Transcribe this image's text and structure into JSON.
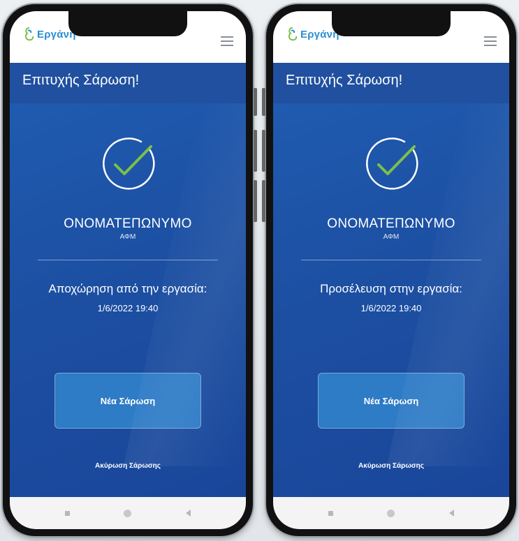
{
  "brand": {
    "logo_text": "Εργάνη",
    "accent_color": "#2a8fd1",
    "header_color": "#20509f"
  },
  "screens": [
    {
      "title": "Επιτυχής Σάρωση!",
      "name": "ΟΝΟΜΑΤΕΠΩΝΥΜΟ",
      "afm_label": "ΑΦΜ",
      "action_label": "Αποχώρηση από την εργασία:",
      "datetime": "1/6/2022 19:40",
      "new_scan_button": "Νέα Σάρωση",
      "cancel_scan_link": "Ακύρωση Σάρωσης"
    },
    {
      "title": "Επιτυχής Σάρωση!",
      "name": "ΟΝΟΜΑΤΕΠΩΝΥΜΟ",
      "afm_label": "ΑΦΜ",
      "action_label": "Προσέλευση στην εργασία:",
      "datetime": "1/6/2022 19:40",
      "new_scan_button": "Νέα Σάρωση",
      "cancel_scan_link": "Ακύρωση Σάρωσης"
    }
  ],
  "icons": {
    "menu": "hamburger-menu-icon",
    "success": "check-circle-icon",
    "nav_recent": "recent-apps-icon",
    "nav_home": "home-icon",
    "nav_back": "back-icon"
  },
  "status_colors": {
    "check_mark": "#7cc04a"
  }
}
